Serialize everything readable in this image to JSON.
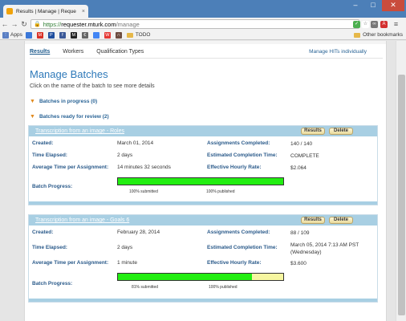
{
  "browser": {
    "tab_title": "Results | Manage | Reque",
    "tab_close": "×",
    "url_scheme": "https://",
    "url_host": "requester.mturk.com",
    "url_path": "/manage",
    "bookmarks": [
      {
        "label": "Apps",
        "icon": "apps-grid-icon",
        "color": "#5a7fc4"
      },
      {
        "label": "",
        "icon": "bookmark-icon",
        "color": "#3b78d8"
      },
      {
        "label": "",
        "icon": "gmail-icon",
        "color": "#d93025"
      },
      {
        "label": "",
        "icon": "paypal-icon",
        "color": "#1f4e9e"
      },
      {
        "label": "",
        "icon": "facebook-icon",
        "color": "#3b5998"
      },
      {
        "label": "",
        "icon": "medium-icon",
        "color": "#222222"
      },
      {
        "label": "",
        "icon": "bookmark-icon",
        "color": "#666666"
      },
      {
        "label": "",
        "icon": "bookmark-icon",
        "color": "#4285f4"
      },
      {
        "label": "",
        "icon": "bookmark-icon",
        "color": "#e53935"
      },
      {
        "label": "",
        "icon": "bookmark-icon",
        "color": "#6d4c41"
      },
      {
        "label": "TODO",
        "icon": "folder-icon",
        "color": "#e6b84a"
      }
    ],
    "other_bookmarks": "Other bookmarks"
  },
  "subnav": {
    "tabs": [
      "Results",
      "Workers",
      "Qualification Types"
    ],
    "right_link": "Manage HITs individually"
  },
  "page": {
    "title": "Manage Batches",
    "intro": "Click on the name of the batch to see more details",
    "section_in_progress": "Batches in progress (0)",
    "section_ready": "Batches ready for review (2)"
  },
  "labels": {
    "created": "Created:",
    "time_elapsed": "Time Elapsed:",
    "avg_time": "Average Time per Assignment:",
    "batch_progress": "Batch Progress:",
    "assignments_completed": "Assignments Completed:",
    "est_completion": "Estimated Completion Time:",
    "hourly_rate": "Effective Hourly Rate:",
    "results_btn": "Results",
    "delete_btn": "Delete"
  },
  "batches": [
    {
      "name": "Transcription from an image - Roles",
      "created": "March 01, 2014",
      "time_elapsed": "2 days",
      "avg_time": "14 minutes 32 seconds",
      "assignments_completed": "140 / 140",
      "est_completion": "COMPLETE",
      "hourly_rate": "$2.064",
      "submitted_fraction": 1.0,
      "submitted_label": "100% submitted",
      "published_label": "100% published"
    },
    {
      "name": "Transcription from an image - Goals 6",
      "created": "February 28, 2014",
      "time_elapsed": "2 days",
      "avg_time": "1 minute",
      "assignments_completed": "88 / 109",
      "est_completion": "March 05, 2014 7:13 AM PST (Wednesday)",
      "hourly_rate": "$3.600",
      "submitted_fraction": 0.81,
      "submitted_label": "81% submitted",
      "published_label": "100% published"
    }
  ],
  "colors": {
    "progress_fill": "#22ee11",
    "progress_remaining": "#f6f6a0",
    "header_bar": "#a8cfe3",
    "title": "#2e79b9"
  }
}
